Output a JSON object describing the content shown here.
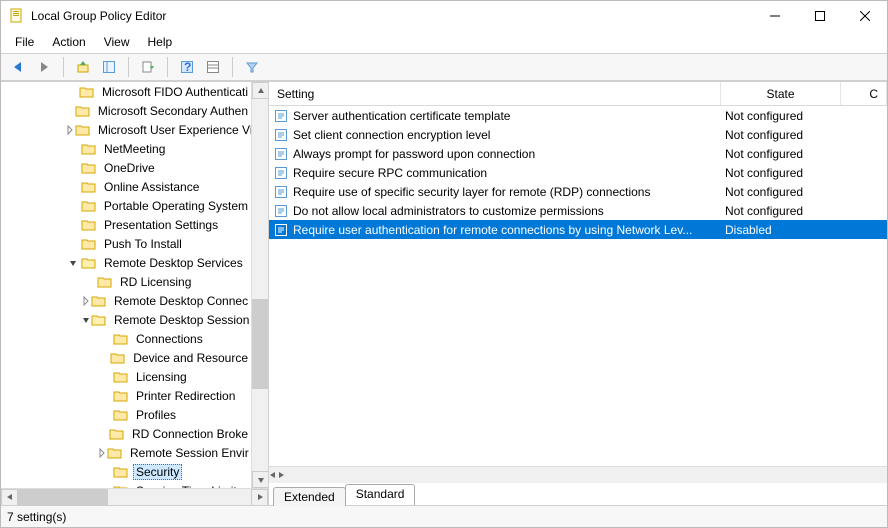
{
  "window": {
    "title": "Local Group Policy Editor"
  },
  "menu": {
    "items": [
      "File",
      "Action",
      "View",
      "Help"
    ]
  },
  "tree": {
    "items": [
      {
        "indent": 4,
        "label": "Microsoft FIDO Authenticati",
        "expander": ""
      },
      {
        "indent": 4,
        "label": "Microsoft Secondary Authen",
        "expander": ""
      },
      {
        "indent": 4,
        "label": "Microsoft User Experience Vi",
        "expander": ">"
      },
      {
        "indent": 4,
        "label": "NetMeeting",
        "expander": ""
      },
      {
        "indent": 4,
        "label": "OneDrive",
        "expander": ""
      },
      {
        "indent": 4,
        "label": "Online Assistance",
        "expander": ""
      },
      {
        "indent": 4,
        "label": "Portable Operating System",
        "expander": ""
      },
      {
        "indent": 4,
        "label": "Presentation Settings",
        "expander": ""
      },
      {
        "indent": 4,
        "label": "Push To Install",
        "expander": ""
      },
      {
        "indent": 4,
        "label": "Remote Desktop Services",
        "expander": "v"
      },
      {
        "indent": 5,
        "label": "RD Licensing",
        "expander": ""
      },
      {
        "indent": 5,
        "label": "Remote Desktop Connec",
        "expander": ">"
      },
      {
        "indent": 5,
        "label": "Remote Desktop Session",
        "expander": "v"
      },
      {
        "indent": 6,
        "label": "Connections",
        "expander": ""
      },
      {
        "indent": 6,
        "label": "Device and Resource",
        "expander": ""
      },
      {
        "indent": 6,
        "label": "Licensing",
        "expander": ""
      },
      {
        "indent": 6,
        "label": "Printer Redirection",
        "expander": ""
      },
      {
        "indent": 6,
        "label": "Profiles",
        "expander": ""
      },
      {
        "indent": 6,
        "label": "RD Connection Broke",
        "expander": ""
      },
      {
        "indent": 6,
        "label": "Remote Session Envir",
        "expander": ">"
      },
      {
        "indent": 6,
        "label": "Security",
        "expander": "",
        "selected": true
      },
      {
        "indent": 6,
        "label": "Session Time Limits",
        "expander": ""
      }
    ]
  },
  "list": {
    "cols": {
      "setting": "Setting",
      "state": "State"
    },
    "rows": [
      {
        "name": "Server authentication certificate template",
        "state": "Not configured"
      },
      {
        "name": "Set client connection encryption level",
        "state": "Not configured"
      },
      {
        "name": "Always prompt for password upon connection",
        "state": "Not configured"
      },
      {
        "name": "Require secure RPC communication",
        "state": "Not configured"
      },
      {
        "name": "Require use of specific security layer for remote (RDP) connections",
        "state": "Not configured"
      },
      {
        "name": "Do not allow local administrators to customize permissions",
        "state": "Not configured"
      },
      {
        "name": "Require user authentication for remote connections by using Network Lev...",
        "state": "Disabled",
        "selected": true
      }
    ]
  },
  "tabs": {
    "extended": "Extended",
    "standard": "Standard"
  },
  "status": {
    "text": "7 setting(s)"
  }
}
